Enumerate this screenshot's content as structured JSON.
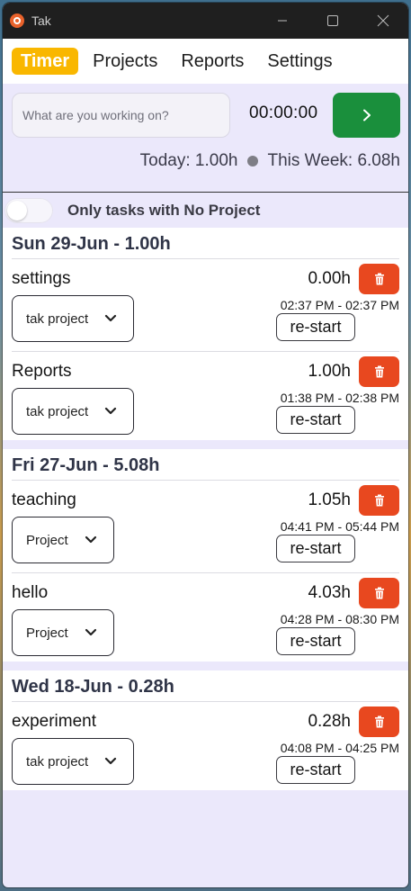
{
  "window": {
    "title": "Tak"
  },
  "nav": {
    "items": [
      {
        "label": "Timer",
        "active": true
      },
      {
        "label": "Projects",
        "active": false
      },
      {
        "label": "Reports",
        "active": false
      },
      {
        "label": "Settings",
        "active": false
      }
    ]
  },
  "entry": {
    "placeholder": "What are you working on?",
    "timer": "00:00:00",
    "play_icon": "play-icon"
  },
  "summary": {
    "today": "Today: 1.00h",
    "week": "This Week: 6.08h"
  },
  "filter": {
    "label": "Only tasks with No Project",
    "enabled": false
  },
  "restart_label": "re-start",
  "days": [
    {
      "header": "Sun 29-Jun - 1.00h",
      "tasks": [
        {
          "name": "settings",
          "project": "tak project",
          "duration": "0.00h",
          "range": "02:37 PM - 02:37 PM"
        },
        {
          "name": "Reports",
          "project": "tak project",
          "duration": "1.00h",
          "range": "01:38 PM - 02:38 PM"
        }
      ]
    },
    {
      "header": "Fri 27-Jun - 5.08h",
      "tasks": [
        {
          "name": "teaching",
          "project": "Project",
          "duration": "1.05h",
          "range": "04:41 PM - 05:44 PM"
        },
        {
          "name": "hello",
          "project": "Project",
          "duration": "4.03h",
          "range": "04:28 PM - 08:30 PM"
        }
      ]
    },
    {
      "header": "Wed 18-Jun - 0.28h",
      "tasks": [
        {
          "name": "experiment",
          "project": "tak project",
          "duration": "0.28h",
          "range": "04:08 PM - 04:25 PM"
        }
      ]
    }
  ],
  "colors": {
    "accent": "#f9b700",
    "play": "#1a8f3c",
    "delete": "#e8481f",
    "background": "#ebe8fb"
  }
}
